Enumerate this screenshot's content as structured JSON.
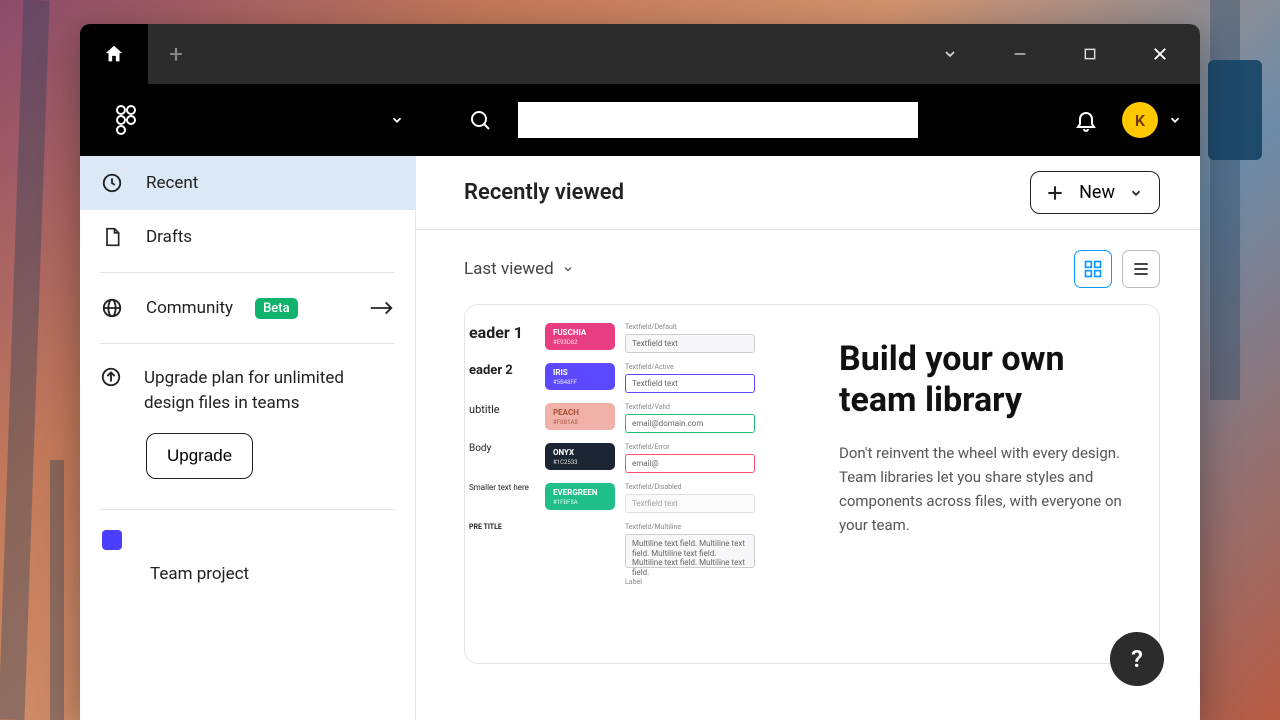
{
  "titlebar": {
    "home_label": "Home",
    "add_tab_label": "+"
  },
  "header": {
    "search_placeholder": "",
    "avatar_initial": "K"
  },
  "sidebar": {
    "items": [
      {
        "label": "Recent",
        "icon": "clock-icon",
        "active": true
      },
      {
        "label": "Drafts",
        "icon": "document-icon",
        "active": false
      }
    ],
    "community_label": "Community",
    "community_badge": "Beta",
    "upgrade_text": "Upgrade plan for unlimited design files in teams",
    "upgrade_button": "Upgrade",
    "team_name": "Team project"
  },
  "main": {
    "title": "Recently viewed",
    "new_button": "New",
    "sort_label": "Last viewed"
  },
  "promo_card": {
    "heading": "Build your own team library",
    "body": "Don't reinvent the wheel with every design. Team libraries let you share styles and components across files, with everyone on your team.",
    "mock": {
      "headers": [
        "eader 1",
        "eader 2",
        "ubtitle",
        "Body",
        "Smaller text here",
        "PRE TITLE"
      ],
      "chips": [
        {
          "name": "FUSCHIA",
          "hex": "#E93D82"
        },
        {
          "name": "IRIS",
          "hex": "#5B48FF"
        },
        {
          "name": "PEACH",
          "hex": "#F0B1A8"
        },
        {
          "name": "ONYX",
          "hex": "#1C2533"
        },
        {
          "name": "EVERGREEN",
          "hex": "#1FBF8A"
        }
      ],
      "textfields": [
        {
          "state": "Textfield/Default",
          "value": "Textfield text"
        },
        {
          "state": "Textfield/Active",
          "value": "Textfield text"
        },
        {
          "state": "Textfield/Valid",
          "value": "email@domain.com"
        },
        {
          "state": "Textfield/Error",
          "value": "email@"
        },
        {
          "state": "Textfield/Disabled",
          "value": "Textfield text"
        },
        {
          "state": "Textfield/Multiline",
          "value": "Multiline text field. Multiline text field. Multiline text field. Multiline text field. Multiline text field."
        },
        {
          "state": "Label",
          "value": ""
        }
      ]
    }
  },
  "help_label": "?"
}
